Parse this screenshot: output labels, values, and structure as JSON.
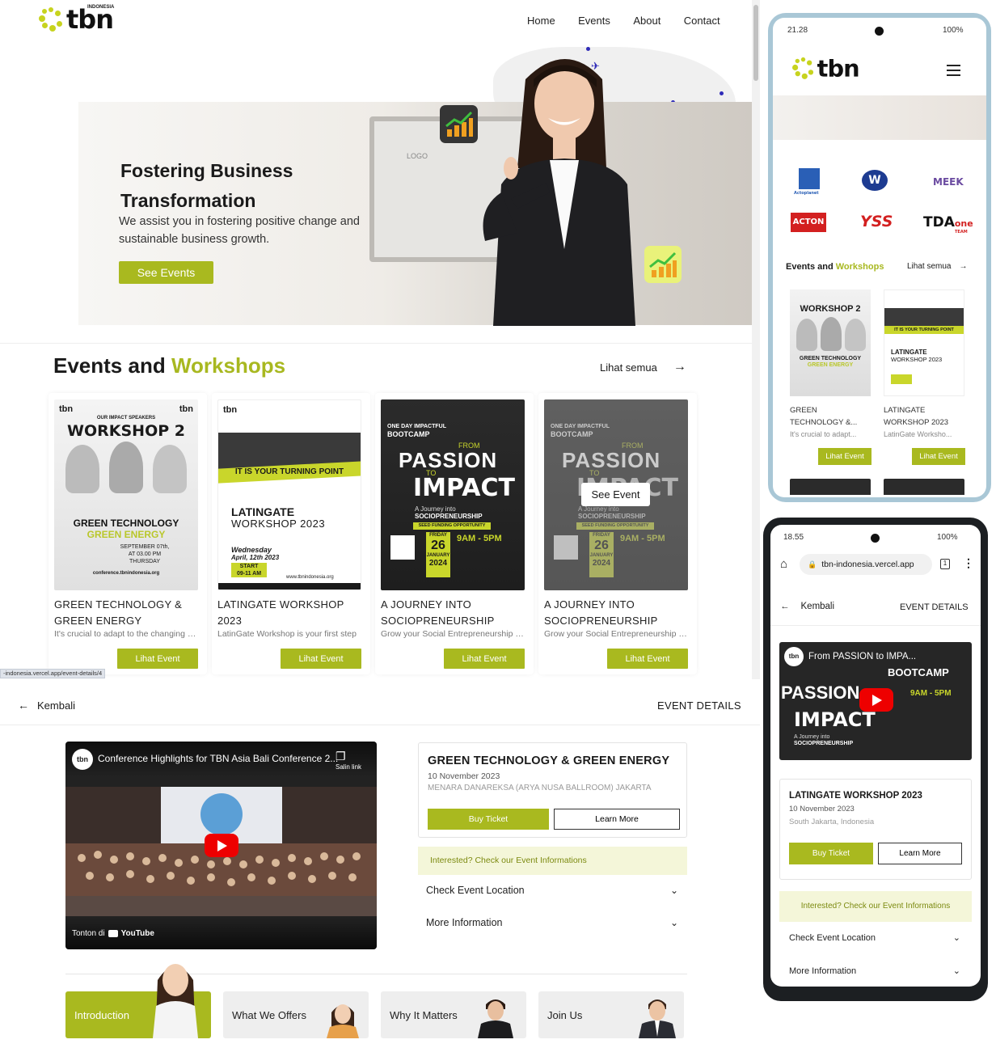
{
  "brand": {
    "name": "tbn",
    "sup": "INDONESIA"
  },
  "nav": {
    "home": "Home",
    "events": "Events",
    "about": "About",
    "contact": "Contact"
  },
  "hero": {
    "title_line1": "Fostering Business",
    "title_line2": "Transformation",
    "subtitle_line1": "We assist you in fostering positive change and",
    "subtitle_line2": "sustainable business growth.",
    "cta": "See Events",
    "monitor_label": "LOGO"
  },
  "events_section": {
    "title_plain": "Events and",
    "title_accent": "Workshops",
    "see_all": "Lihat semua"
  },
  "events": [
    {
      "title_line1": "GREEN TECHNOLOGY &",
      "title_line2": "GREEN ENERGY",
      "desc": "It's crucial to adapt to the changing world",
      "button": "Lihat Event",
      "poster": {
        "headline": "WORKSHOP 2",
        "kicker": "OUR IMPACT SPEAKERS",
        "band1": "GREEN TECHNOLOGY",
        "band2": "GREEN ENERGY",
        "date1": "SEPTEMBER 07th,",
        "date2": "AT 03.00 PM",
        "date3": "THURSDAY",
        "site": "conference.tbnindonesia.org"
      }
    },
    {
      "title_line1": "LATINGATE WORKSHOP",
      "title_line2": "2023",
      "desc": "LatinGate Workshop is your first step",
      "button": "Lihat Event",
      "poster": {
        "ribbon": "IT IS YOUR TURNING POINT",
        "name1": "LATINGATE",
        "name2": "WORKSHOP 2023",
        "day": "Wednesday",
        "date": "April, 12th 2023",
        "start1": "START",
        "start2": "09-11 AM",
        "site": "www.tbnindonesia.org"
      }
    },
    {
      "title_line1": "A JOURNEY INTO",
      "title_line2": "SOCIOPRENEURSHIP",
      "desc": "Grow your Social Entrepreneurship skills",
      "button": "Lihat Event",
      "poster": {
        "top": "ONE DAY IMPACTFUL",
        "type": "BOOTCAMP",
        "from": "FROM",
        "w1": "PASSION",
        "to": "TO",
        "w2": "IMPACT",
        "sub1": "A Journey into",
        "sub2": "SOCIOPRENEURSHIP",
        "badge": "SEED FUNDING OPPORTUNITY",
        "day": "FRIDAY",
        "num": "26",
        "month": "JANUARY",
        "year": "2024",
        "time": "9AM - 5PM"
      }
    },
    {
      "title_line1": "A JOURNEY INTO",
      "title_line2": "SOCIOPRENEURSHIP",
      "desc": "Grow your Social Entrepreneurship skills",
      "button": "Lihat Event",
      "hover_label": "See Event",
      "poster": {
        "top": "ONE DAY IMPACTFUL",
        "type": "BOOTCAMP",
        "from": "FROM",
        "w1": "PASSION",
        "to": "TO",
        "w2": "IMPACT",
        "sub1": "A Journey into",
        "sub2": "SOCIOPRENEURSHIP",
        "badge": "SEED FUNDING OPPORTUNITY",
        "day": "FRIDAY",
        "num": "26",
        "month": "JANUARY",
        "year": "2024",
        "time": "9AM - 5PM"
      }
    }
  ],
  "status_url": "-indonesia.vercel.app/event-details/4",
  "detail": {
    "back": "Kembali",
    "header": "EVENT DETAILS",
    "video_title": "Conference Highlights for TBN Asia Bali Conference 2...",
    "copy_link": "Salin link",
    "watch_on": "Tonton di",
    "youtube": "YouTube",
    "event_title": "GREEN TECHNOLOGY & GREEN ENERGY",
    "event_date": "10 November 2023",
    "event_venue": "MENARA DANAREKSA (ARYA NUSA BALLROOM) JAKARTA",
    "buy": "Buy Ticket",
    "learn": "Learn More",
    "notice": "Interested? Check our Event Informations",
    "accordion_location": "Check Event Location",
    "accordion_more": "More Information",
    "tabs": [
      "Introduction",
      "What We Offers",
      "Why It Matters",
      "Join Us"
    ]
  },
  "phone1": {
    "time": "21.28",
    "battery": "100%",
    "section_plain": "Events and",
    "section_accent": "Workshops",
    "see_all": "Lihat semua",
    "sponsors": [
      "Actoplanet",
      "W",
      "MEEK",
      "ACTON",
      "YSS",
      "TDA",
      "one",
      "TEAM"
    ],
    "cards": [
      {
        "t1": "GREEN",
        "t2": "TECHNOLOGY &...",
        "desc": "It's crucial to adapt...",
        "button": "Lihat Event"
      },
      {
        "t1": "LATINGATE",
        "t2": "WORKSHOP 2023",
        "desc": "LatinGate Worksho...",
        "button": "Lihat Event"
      }
    ]
  },
  "phone2": {
    "time": "18.55",
    "battery": "100%",
    "url": "tbn-indonesia.vercel.app",
    "back": "Kembali",
    "header": "EVENT DETAILS",
    "video_title": "From PASSION to IMPA...",
    "event_title": "LATINGATE WORKSHOP 2023",
    "event_date": "10 November 2023",
    "event_venue": "South Jakarta, Indonesia",
    "buy": "Buy Ticket",
    "learn": "Learn More",
    "notice": "Interested? Check our Event Informations",
    "accordion_location": "Check Event Location",
    "accordion_more": "More Information"
  },
  "colors": {
    "accent": "#a9b91f",
    "logo_dot": "#c7d31e",
    "notice_bg": "#f4f6d9",
    "youtube_red": "#ee0000"
  }
}
